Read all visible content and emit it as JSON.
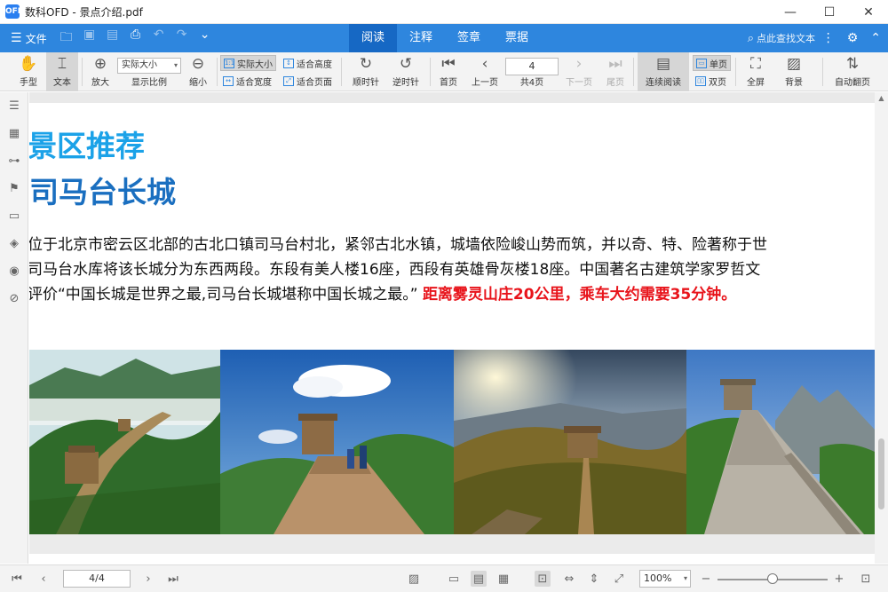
{
  "window": {
    "logo_text": "OFD",
    "title": "数科OFD - 景点介绍.pdf",
    "minimize": "—",
    "maximize": "☐",
    "close": "✕"
  },
  "menubar": {
    "file_label": "文件",
    "tabs": [
      "阅读",
      "注释",
      "签章",
      "票据"
    ],
    "active_tab": "阅读",
    "search_placeholder": "点此查找文本",
    "accent_color": "#2e86de",
    "active_tab_color": "#1668c4"
  },
  "toolbar": {
    "hand": "手型",
    "text": "文本",
    "zoom_in": "放大",
    "zoom_value": "实际大小",
    "display_ratio": "显示比例",
    "zoom_out": "缩小",
    "actual_size": "实际大小",
    "fit_height": "适合高度",
    "fit_width": "适合宽度",
    "fit_page": "适合页面",
    "rotate_cw": "顺时针",
    "rotate_ccw": "逆时针",
    "first_page": "首页",
    "prev_page": "上一页",
    "page_input": "4",
    "total_pages": "共4页",
    "next_page": "下一页",
    "last_page": "尾页",
    "continuous": "连续阅读",
    "single_page": "单页",
    "double_page": "双页",
    "fullscreen": "全屏",
    "background": "背景",
    "auto_flip": "自动翻页"
  },
  "document": {
    "heading1": "景区推荐",
    "heading2": "司马台长城",
    "lines": [
      "位于北京市密云区北部的古北口镇司马台村北，紧邻古北水镇，城墙依险峻山势而筑，并以奇、特、险著称于世",
      "司马台水库将该长城分为东西两段。东段有美人楼16座，西段有英雄骨灰楼18座。中国著名古建筑学家罗哲文",
      "评价“中国长城是世界之最,司马台长城堪称中国长城之最。”"
    ],
    "highlight": "距离雾灵山庄20公里，乘车大约需要35分钟。",
    "heading1_color": "#1ba2e8",
    "heading2_color": "#1a6fc0",
    "highlight_color": "#e8141b"
  },
  "statusbar": {
    "page_display": "4/4",
    "zoom_display": "100%"
  }
}
